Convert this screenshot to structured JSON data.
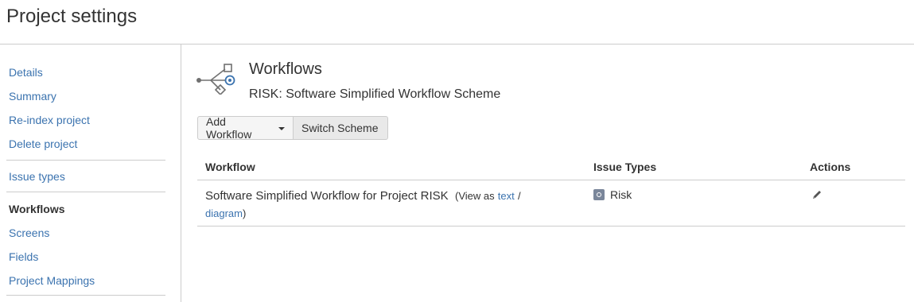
{
  "header": {
    "title": "Project settings"
  },
  "sidebar": {
    "groups": [
      {
        "items": [
          {
            "label": "Details"
          },
          {
            "label": "Summary"
          },
          {
            "label": "Re-index project"
          },
          {
            "label": "Delete project"
          }
        ]
      },
      {
        "items": [
          {
            "label": "Issue types"
          }
        ]
      },
      {
        "items": [
          {
            "label": "Workflows",
            "active": true
          },
          {
            "label": "Screens"
          },
          {
            "label": "Fields"
          },
          {
            "label": "Project Mappings"
          }
        ]
      }
    ]
  },
  "main": {
    "title": "Workflows",
    "scheme": "RISK: Software Simplified Workflow Scheme",
    "buttons": {
      "add_workflow": "Add Workflow",
      "switch_scheme": "Switch Scheme"
    },
    "table": {
      "headers": {
        "workflow": "Workflow",
        "issue_types": "Issue Types",
        "actions": "Actions"
      },
      "rows": [
        {
          "name": "Software Simplified Workflow for Project RISK",
          "view_as": "(View as",
          "text_link": "text",
          "separator": "/",
          "diagram_link": "diagram",
          "close_paren": ")",
          "issue_type": "Risk",
          "action_icon": "pencil-icon"
        }
      ]
    }
  },
  "icons": {
    "workflow": "workflow-icon",
    "issue_type": "risk-icon",
    "edit": "pencil-icon"
  },
  "colors": {
    "link": "#3b73af",
    "text": "#333333",
    "border": "#cccccc",
    "risk_icon": "#7a869a"
  }
}
